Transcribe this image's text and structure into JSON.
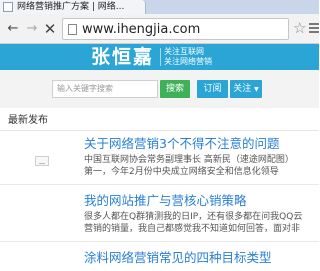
{
  "browser": {
    "tab_title": "网络营销推广方案 | 网络...",
    "url": "www.ihengjia.com",
    "icons": {
      "back": "back-arrow-icon",
      "forward": "forward-arrow-icon",
      "stop": "stop-x-icon",
      "star": "bookmark-star-icon",
      "menu": "hamburger-menu-icon"
    }
  },
  "site": {
    "logo": "张恒嘉",
    "slogan_line1": "关注互联网",
    "slogan_line2": "关注网络营销",
    "brand_color": "#2aa5d6"
  },
  "search": {
    "placeholder": "输入关键字搜索",
    "search_label": "搜索",
    "subscribe_label": "订阅",
    "follow_label": "关注",
    "follow_caret": "▼",
    "search_button_color": "#3fb158"
  },
  "content": {
    "section_title": "最新发布",
    "articles": [
      {
        "title": "关于网络营销3个不得不注意的问题",
        "desc_line1": "中国互联网协会常务副理事长 高新民（速途网配图）",
        "desc_line2": "第一，今年2月份中央成立网络安全和信息化领导"
      },
      {
        "title": "我的网站推广与营核心销策略",
        "desc_line1": "很多人都在Q群猜测我的日IP，还有很多都在问我QQ云",
        "desc_line2": "营销的销量，我自己都感觉我不知道如何回答，面对非"
      },
      {
        "title": "涂料网络营销常见的四种目标类型"
      }
    ]
  }
}
